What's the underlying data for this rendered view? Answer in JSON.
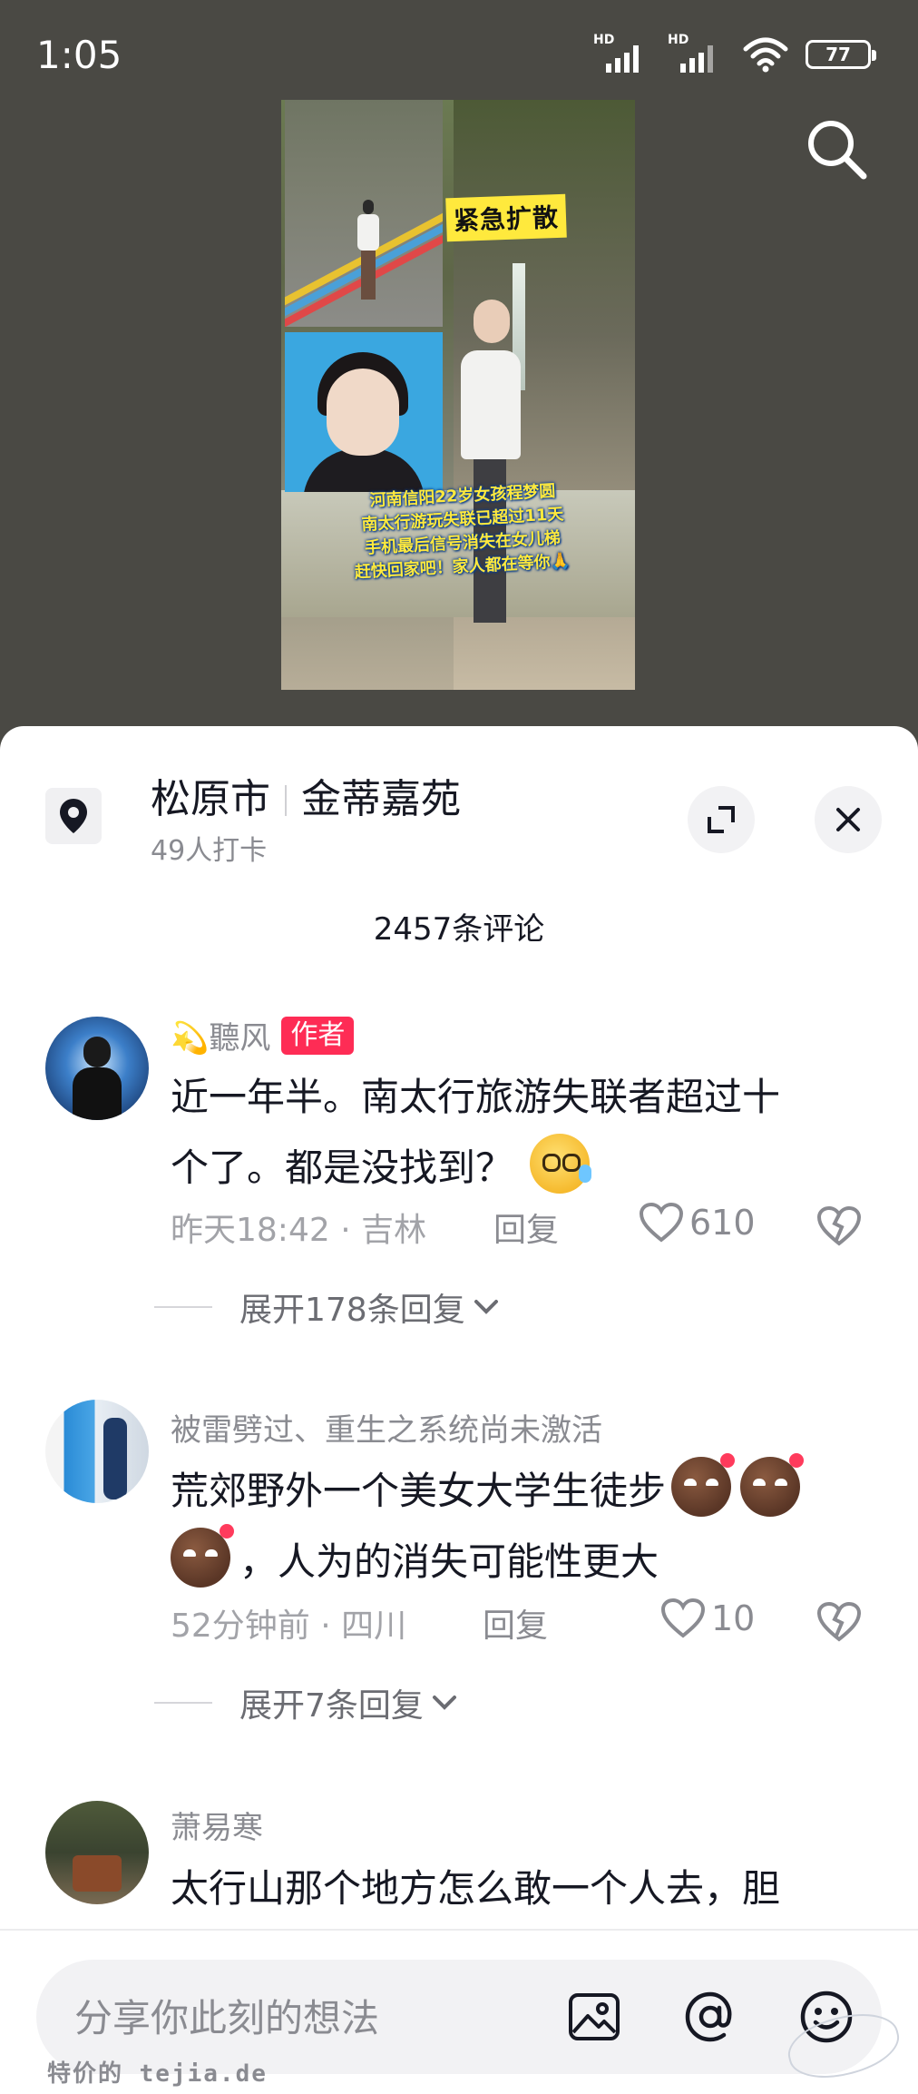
{
  "status_bar": {
    "time": "1:05",
    "signal_1_tag": "HD",
    "signal_2_tag": "HD",
    "battery": "77"
  },
  "video": {
    "banner_title": "紧急扩散",
    "captions": [
      "河南信阳22岁女孩程梦圆",
      "南太行游玩失联已超过11天",
      "手机最后信号消失在女儿梯",
      "赶快回家吧！家人都在等你🙏"
    ]
  },
  "location": {
    "city": "松原市",
    "place": "金蒂嘉苑",
    "checkins": "49人打卡"
  },
  "comment_count": "2457条评论",
  "comments": [
    {
      "user": "💫聽风",
      "badge": "作者",
      "text_line1": "近一年半。南太行旅游失联者超过十",
      "text_line2": "个了。都是没找到？",
      "emoji": "sweat-smile-emoji",
      "meta": "昨天18:42 · 吉林",
      "reply": "回复",
      "likes": "610",
      "expand": "展开178条回复"
    },
    {
      "user": "被雷劈过、重生之系统尚未激活",
      "text_line1": "荒郊野外一个美女大学生徒步",
      "text_line2": "，人为的消失可能性更大",
      "emoji": "smirk-emoji",
      "meta": "52分钟前 · 四川",
      "reply": "回复",
      "likes": "10",
      "expand": "展开7条回复"
    },
    {
      "user": "萧易寒",
      "text_line1": "太行山那个地方怎么敢一个人去，胆"
    }
  ],
  "input": {
    "placeholder": "分享你此刻的想法"
  },
  "watermark": "特价的 tejia.de",
  "colors": {
    "accent": "#fe2c55",
    "sheet_bg": "#ffffff",
    "dimmed_bg": "#4a4944",
    "secondary_text": "#8a8b91"
  }
}
